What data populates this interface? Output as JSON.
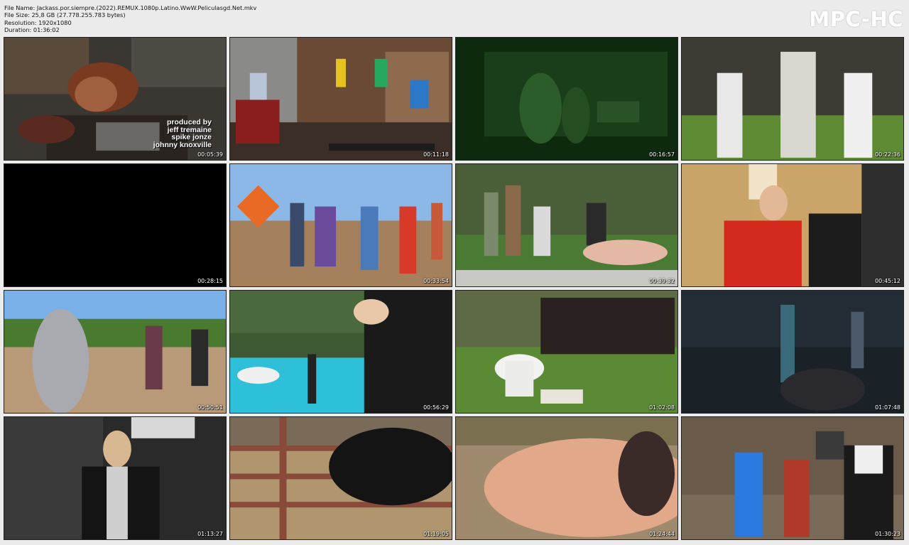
{
  "file_info": {
    "name": "File Name: Jackass.por.siempre.(2022).REMUX.1080p.Latino.WwW.Peliculasgd.Net.mkv",
    "size": "File Size: 25,8 GB (27.778.255.783 bytes)",
    "resolution": "Resolution: 1920x1080",
    "duration": "Duration: 01:36:02"
  },
  "brand": "MPC-HC",
  "thumbnails": [
    {
      "timestamp": "00:05:39",
      "scene": "burning-wreckage"
    },
    {
      "timestamp": "00:11:18",
      "scene": "exercise-machines-room"
    },
    {
      "timestamp": "00:16:57",
      "scene": "night-vision"
    },
    {
      "timestamp": "00:22:36",
      "scene": "beekeeper-outdoors"
    },
    {
      "timestamp": "00:28:15",
      "scene": "black-frame"
    },
    {
      "timestamp": "00:33:54",
      "scene": "dry-field-group"
    },
    {
      "timestamp": "00:39:32",
      "scene": "lawn-stunt"
    },
    {
      "timestamp": "00:45:12",
      "scene": "indoor-group"
    },
    {
      "timestamp": "00:50:51",
      "scene": "silver-suit-arena"
    },
    {
      "timestamp": "00:56:29",
      "scene": "pool-crew"
    },
    {
      "timestamp": "01:02:08",
      "scene": "toilet-on-lawn"
    },
    {
      "timestamp": "01:07:48",
      "scene": "dark-glow-stage"
    },
    {
      "timestamp": "01:13:27",
      "scene": "portrait-studio"
    },
    {
      "timestamp": "01:19:05",
      "scene": "bull-pen"
    },
    {
      "timestamp": "01:24:44",
      "scene": "closeup-blur"
    },
    {
      "timestamp": "01:30:23",
      "scene": "end-credits-street"
    }
  ],
  "overlay_credit": {
    "line1": "produced by",
    "line2": "jeff tremaine",
    "line3": "spike jonze",
    "line4": "johnny knoxville"
  },
  "colors": {
    "page_background": "#ececec",
    "timestamp_text": "#ffffff",
    "brand_text": "#ffffff"
  }
}
